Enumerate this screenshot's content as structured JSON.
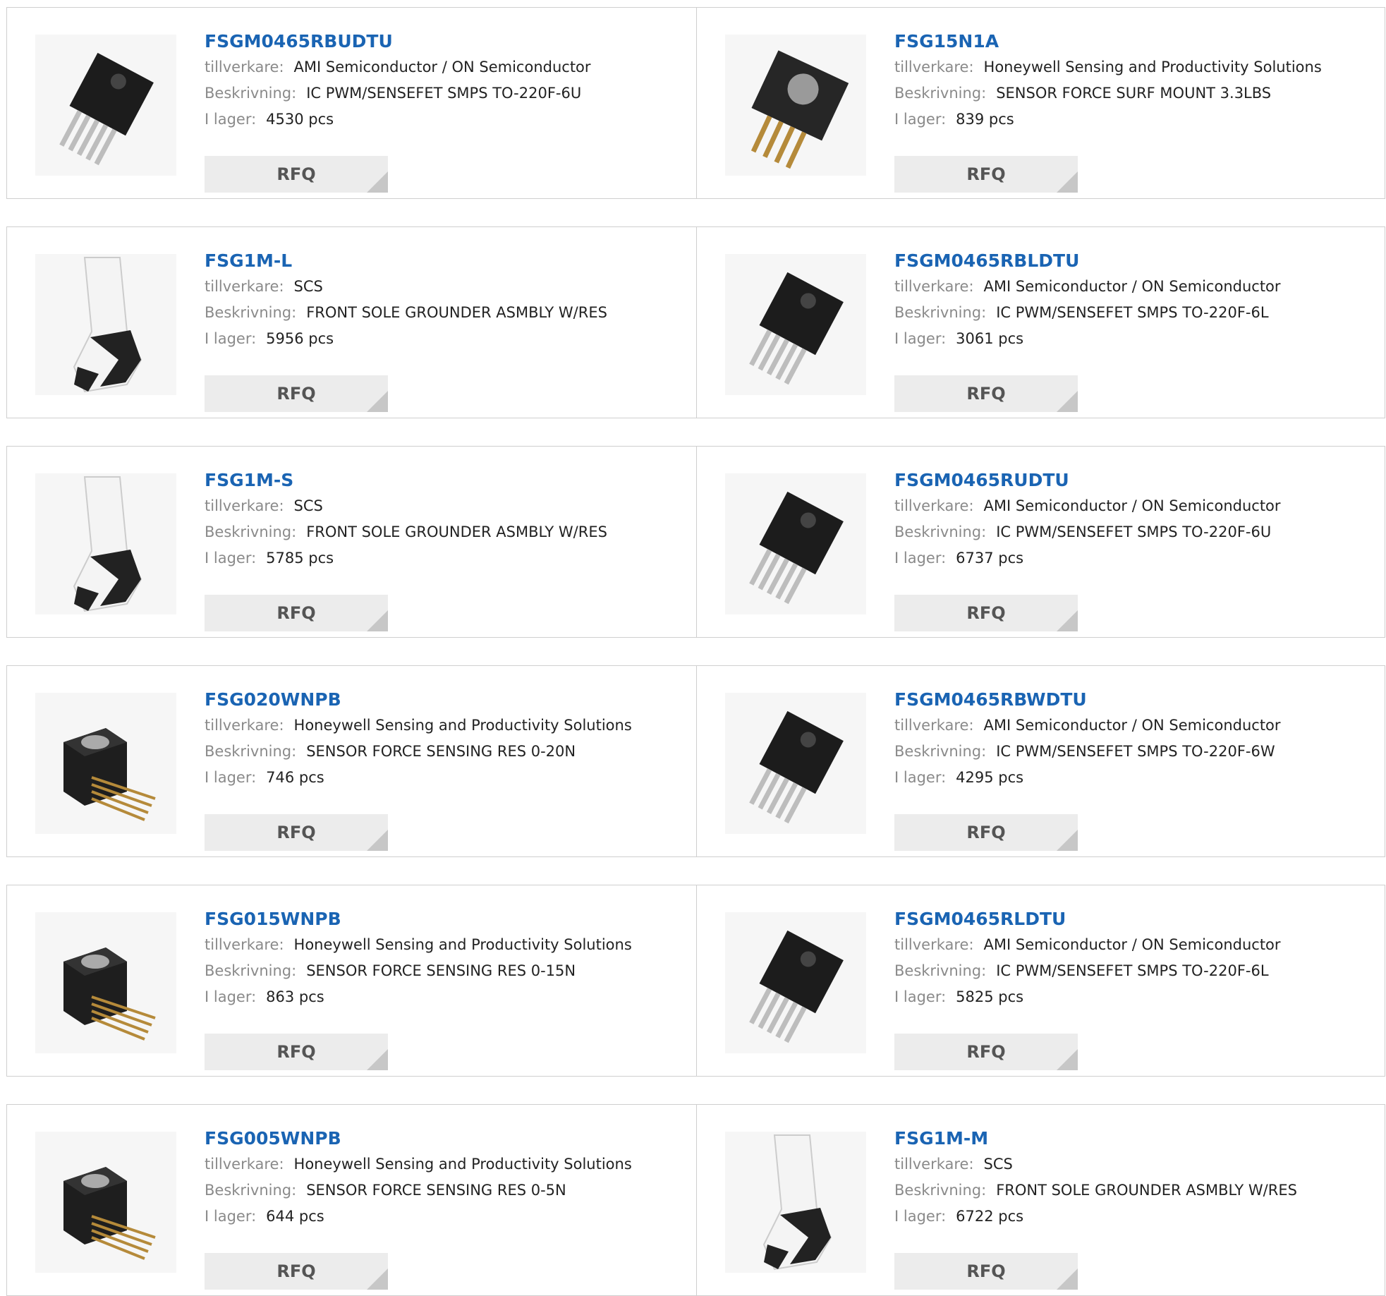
{
  "labels": {
    "manufacturer": "tillverkare:",
    "description": "Beskrivning:",
    "stock": "I lager:",
    "rfq": "RFQ"
  },
  "products": [
    {
      "name": "FSGM0465RBUDTU",
      "manufacturer": "AMI Semiconductor / ON Semiconductor",
      "description": "IC PWM/SENSEFET SMPS TO-220F-6U",
      "stock": "4530 pcs",
      "image": "to220-chip-icon"
    },
    {
      "name": "FSG15N1A",
      "manufacturer": "Honeywell Sensing and Productivity Solutions",
      "description": "SENSOR FORCE SURF MOUNT 3.3LBS",
      "stock": "839 pcs",
      "image": "force-sensor-icon"
    },
    {
      "name": "FSG1M-L",
      "manufacturer": "SCS",
      "description": "FRONT SOLE GROUNDER ASMBLY W/RES",
      "stock": "5956 pcs",
      "image": "foot-grounder-icon"
    },
    {
      "name": "FSGM0465RBLDTU",
      "manufacturer": "AMI Semiconductor / ON Semiconductor",
      "description": "IC PWM/SENSEFET SMPS TO-220F-6L",
      "stock": "3061 pcs",
      "image": "to220-chip-icon"
    },
    {
      "name": "FSG1M-S",
      "manufacturer": "SCS",
      "description": "FRONT SOLE GROUNDER ASMBLY W/RES",
      "stock": "5785 pcs",
      "image": "foot-grounder-icon"
    },
    {
      "name": "FSGM0465RUDTU",
      "manufacturer": "AMI Semiconductor / ON Semiconductor",
      "description": "IC PWM/SENSEFET SMPS TO-220F-6U",
      "stock": "6737 pcs",
      "image": "to220-chip-icon"
    },
    {
      "name": "FSG020WNPB",
      "manufacturer": "Honeywell Sensing and Productivity Solutions",
      "description": "SENSOR FORCE SENSING RES 0-20N",
      "stock": "746 pcs",
      "image": "force-sensor-cube-icon"
    },
    {
      "name": "FSGM0465RBWDTU",
      "manufacturer": "AMI Semiconductor / ON Semiconductor",
      "description": "IC PWM/SENSEFET SMPS TO-220F-6W",
      "stock": "4295 pcs",
      "image": "to220-chip-icon"
    },
    {
      "name": "FSG015WNPB",
      "manufacturer": "Honeywell Sensing and Productivity Solutions",
      "description": "SENSOR FORCE SENSING RES 0-15N",
      "stock": "863 pcs",
      "image": "force-sensor-cube-icon"
    },
    {
      "name": "FSGM0465RLDTU",
      "manufacturer": "AMI Semiconductor / ON Semiconductor",
      "description": "IC PWM/SENSEFET SMPS TO-220F-6L",
      "stock": "5825 pcs",
      "image": "to220-chip-icon"
    },
    {
      "name": "FSG005WNPB",
      "manufacturer": "Honeywell Sensing and Productivity Solutions",
      "description": "SENSOR FORCE SENSING RES 0-5N",
      "stock": "644 pcs",
      "image": "force-sensor-cube-icon"
    },
    {
      "name": "FSG1M-M",
      "manufacturer": "SCS",
      "description": "FRONT SOLE GROUNDER ASMBLY W/RES",
      "stock": "6722 pcs",
      "image": "foot-grounder-icon"
    }
  ]
}
